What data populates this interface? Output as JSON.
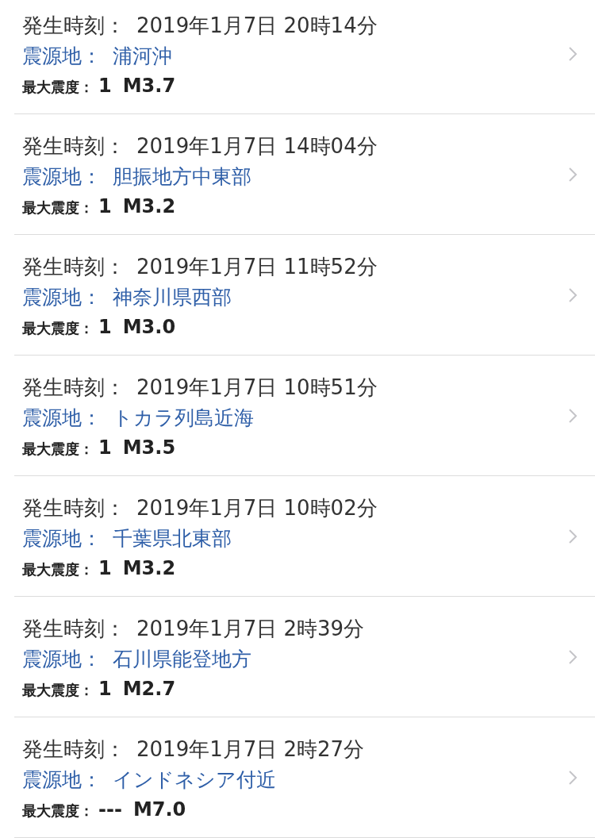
{
  "quakes": [
    {
      "time_label": "発生時刻：",
      "time": "2019年1月7日 20時14分",
      "epicenter_label": "震源地：",
      "epicenter": "浦河沖",
      "intensity_label": "最大震度：",
      "intensity": "1",
      "magnitude": "M3.7"
    },
    {
      "time_label": "発生時刻：",
      "time": "2019年1月7日 14時04分",
      "epicenter_label": "震源地：",
      "epicenter": "胆振地方中東部",
      "intensity_label": "最大震度：",
      "intensity": "1",
      "magnitude": "M3.2"
    },
    {
      "time_label": "発生時刻：",
      "time": "2019年1月7日 11時52分",
      "epicenter_label": "震源地：",
      "epicenter": "神奈川県西部",
      "intensity_label": "最大震度：",
      "intensity": "1",
      "magnitude": "M3.0"
    },
    {
      "time_label": "発生時刻：",
      "time": "2019年1月7日 10時51分",
      "epicenter_label": "震源地：",
      "epicenter": "トカラ列島近海",
      "intensity_label": "最大震度：",
      "intensity": "1",
      "magnitude": "M3.5"
    },
    {
      "time_label": "発生時刻：",
      "time": "2019年1月7日 10時02分",
      "epicenter_label": "震源地：",
      "epicenter": "千葉県北東部",
      "intensity_label": "最大震度：",
      "intensity": "1",
      "magnitude": "M3.2"
    },
    {
      "time_label": "発生時刻：",
      "time": "2019年1月7日 2時39分",
      "epicenter_label": "震源地：",
      "epicenter": "石川県能登地方",
      "intensity_label": "最大震度：",
      "intensity": "1",
      "magnitude": "M2.7"
    },
    {
      "time_label": "発生時刻：",
      "time": "2019年1月7日 2時27分",
      "epicenter_label": "震源地：",
      "epicenter": "インドネシア付近",
      "intensity_label": "最大震度：",
      "intensity": "---",
      "magnitude": "M7.0"
    }
  ]
}
